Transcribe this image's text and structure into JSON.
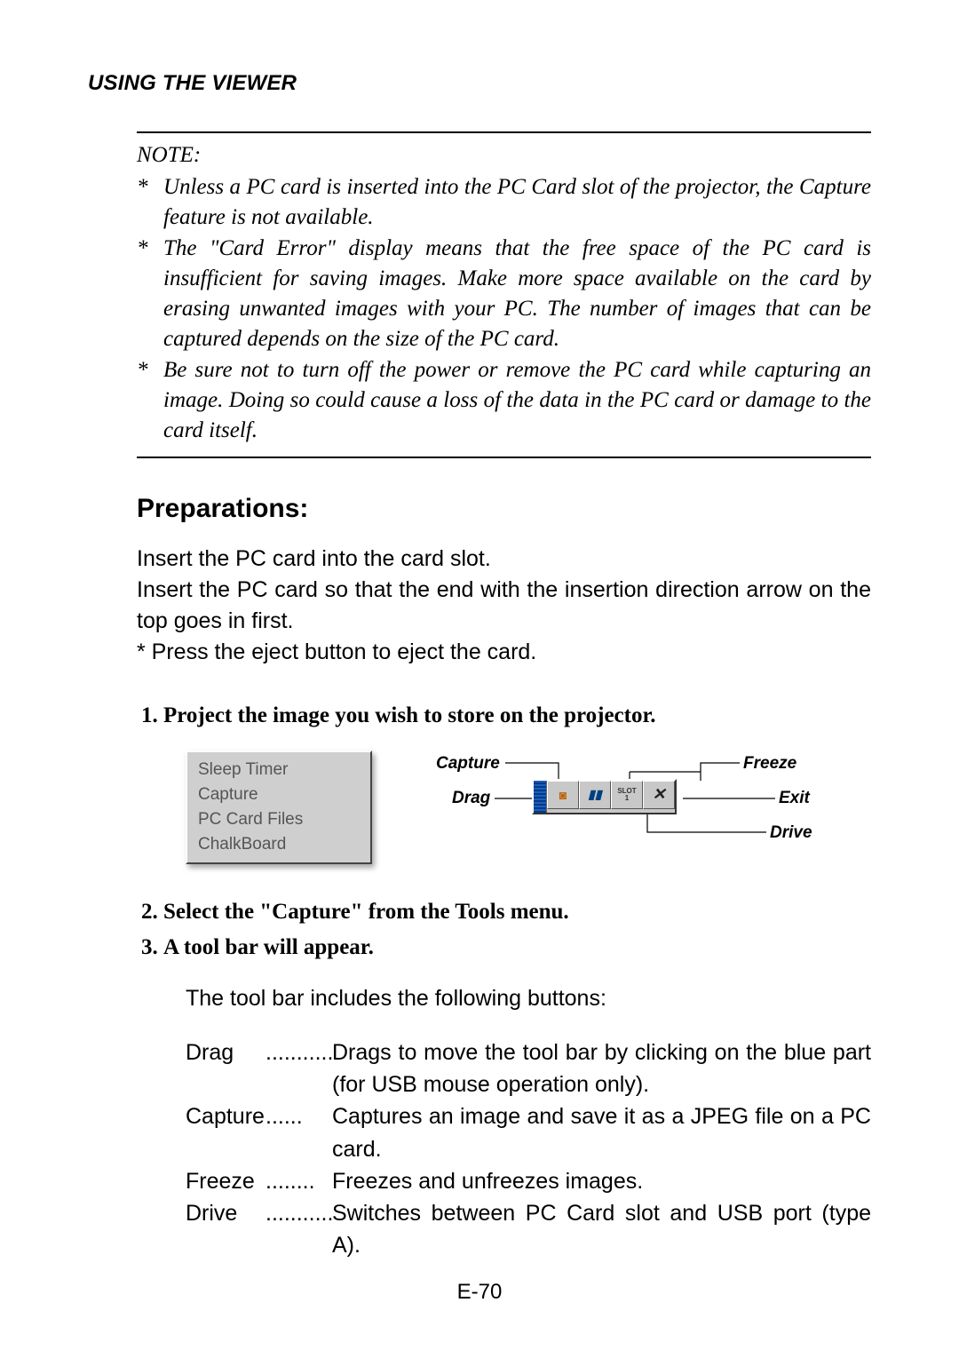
{
  "header": "USING THE VIEWER",
  "note": {
    "title": "NOTE:",
    "items": [
      "Unless a PC card is inserted into the PC Card slot of the projector, the Capture feature is not available.",
      "The \"Card Error\" display means that the free space of the PC card is insufficient for saving images. Make more space available on the card by erasing unwanted images with your PC. The number of images that can be captured depends on the size of the PC card.",
      "Be sure not to turn off the power or remove the PC card while capturing an image. Doing so could cause a loss of the data in the PC card or damage to the card itself."
    ]
  },
  "section_heading": "Preparations:",
  "prep_lines": [
    "Insert the PC card into the card slot.",
    "Insert the PC card so that the end with the insertion direction arrow on the top goes in first.",
    "* Press the eject button to eject the card."
  ],
  "steps": [
    "Project the image you wish to store on the projector.",
    "Select the \"Capture\" from the Tools menu.",
    "A tool bar will appear."
  ],
  "tools_menu": {
    "items": [
      "Sleep Timer",
      "Capture",
      "PC Card Files",
      "ChalkBoard"
    ]
  },
  "toolbar_labels": {
    "capture": "Capture",
    "freeze": "Freeze",
    "drag": "Drag",
    "exit": "Exit",
    "drive": "Drive",
    "drive_btn_top": "SLOT",
    "drive_btn_bot": "1"
  },
  "followup": "The tool bar includes the following buttons:",
  "defs": [
    {
      "term": "Drag",
      "dots": "...........",
      "desc": "Drags to move the tool bar by clicking on the blue part (for USB mouse operation only)."
    },
    {
      "term": "Capture",
      "dots": "......",
      "desc": "Captures an image and save it as a JPEG file on a PC card."
    },
    {
      "term": "Freeze",
      "dots": "........",
      "desc": "Freezes and unfreezes images."
    },
    {
      "term": "Drive",
      "dots": "...........",
      "desc": "Switches between PC Card slot and USB port (type A)."
    }
  ],
  "page_number": "E-70"
}
